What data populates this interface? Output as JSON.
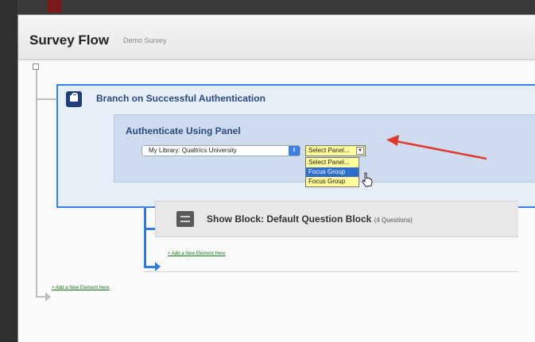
{
  "header": {
    "title": "Survey Flow",
    "subtitle": "Demo Survey"
  },
  "branch": {
    "title": "Branch on Successful Authentication",
    "icon": "lock-icon"
  },
  "authenticate": {
    "title": "Authenticate Using Panel",
    "library_select_value": "My Library: Qualtrics University",
    "panel_select_value": "Select Panel...",
    "panel_options": [
      "Select Panel...",
      "Focus Group",
      "Focus Group"
    ],
    "highlighted_option_index": 1
  },
  "show_block": {
    "title": "Show Block: Default Question Block",
    "count": "(4 Questions)",
    "icon": "block-icon"
  },
  "add_inner_label": "+ Add a New Element Here",
  "add_outer_label": "+ Add a New Element Here",
  "colors": {
    "accent_blue": "#3b82e6",
    "arrow_red": "#e0392f",
    "panel_select_bg": "#fffd9a",
    "link_green": "#1a7a1a"
  }
}
